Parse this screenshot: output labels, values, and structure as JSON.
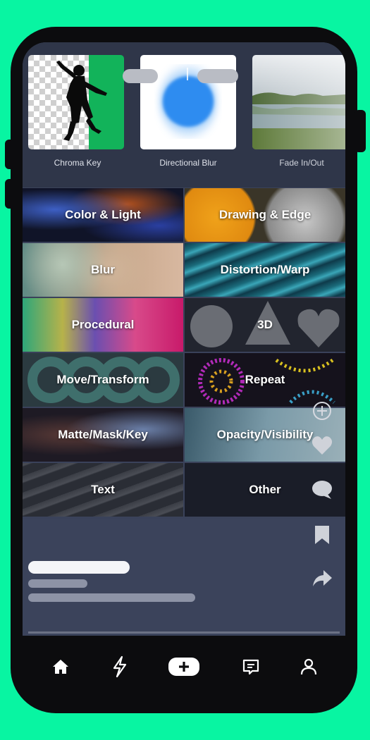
{
  "effects": [
    {
      "label": "Chroma Key",
      "icon": "chroma-key-thumbnail"
    },
    {
      "label": "Directional Blur",
      "icon": "directional-blur-thumbnail"
    },
    {
      "label": "Fade In/Out",
      "icon": "fade-in-out-thumbnail"
    }
  ],
  "categories": [
    {
      "label": "Color & Light"
    },
    {
      "label": "Drawing & Edge"
    },
    {
      "label": "Blur"
    },
    {
      "label": "Distortion/Warp"
    },
    {
      "label": "Procedural"
    },
    {
      "label": "3D"
    },
    {
      "label": "Move/Transform"
    },
    {
      "label": "Repeat"
    },
    {
      "label": "Matte/Mask/Key"
    },
    {
      "label": "Opacity/Visibility"
    },
    {
      "label": "Text"
    },
    {
      "label": "Other"
    }
  ],
  "actions": [
    "add-circle-icon",
    "heart-icon",
    "comment-icon",
    "bookmark-icon",
    "share-icon"
  ],
  "nav": [
    "home-icon",
    "lightning-icon",
    "create-icon",
    "messages-icon",
    "profile-icon"
  ],
  "colors": {
    "background": "#08f5a2",
    "screen": "#3a425a",
    "accent_green": "#12b35a"
  }
}
